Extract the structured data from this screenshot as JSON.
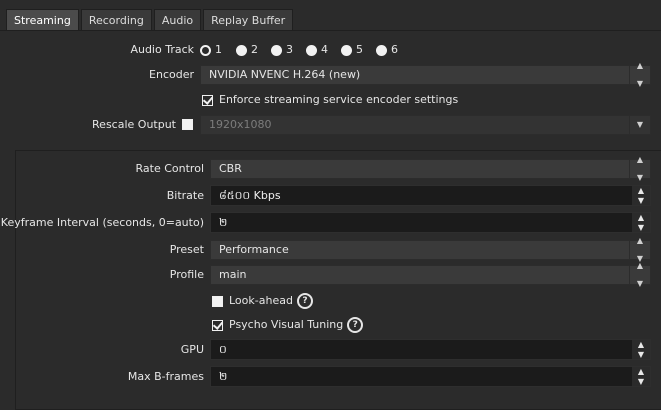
{
  "tabs": [
    {
      "label": "Streaming",
      "active": true
    },
    {
      "label": "Recording",
      "active": false
    },
    {
      "label": "Audio",
      "active": false
    },
    {
      "label": "Replay Buffer",
      "active": false
    }
  ],
  "audio_track": {
    "label": "Audio Track",
    "options": [
      "1",
      "2",
      "3",
      "4",
      "5",
      "6"
    ],
    "selected": "1"
  },
  "encoder": {
    "label": "Encoder",
    "value": "NVIDIA NVENC H.264 (new)"
  },
  "enforce": {
    "label": "Enforce streaming service encoder settings",
    "checked": true
  },
  "rescale": {
    "label": "Rescale Output",
    "checked": false,
    "value": "1920x1080"
  },
  "rate_control": {
    "label": "Rate Control",
    "value": "CBR"
  },
  "bitrate": {
    "label": "Bitrate",
    "value": "៨៥០០ Kbps"
  },
  "keyframe": {
    "label": "Keyframe Interval (seconds, 0=auto)",
    "value": "២"
  },
  "preset": {
    "label": "Preset",
    "value": "Performance"
  },
  "profile": {
    "label": "Profile",
    "value": "main"
  },
  "lookahead": {
    "label": "Look-ahead",
    "checked": false
  },
  "psycho": {
    "label": "Psycho Visual Tuning",
    "checked": true
  },
  "gpu": {
    "label": "GPU",
    "value": "០"
  },
  "bframes": {
    "label": "Max B-frames",
    "value": "២"
  },
  "colors": {
    "bg": "#2b2b2b",
    "field": "#1b1b1b",
    "combo": "#3a3a3a",
    "text": "#e6e6e6"
  }
}
